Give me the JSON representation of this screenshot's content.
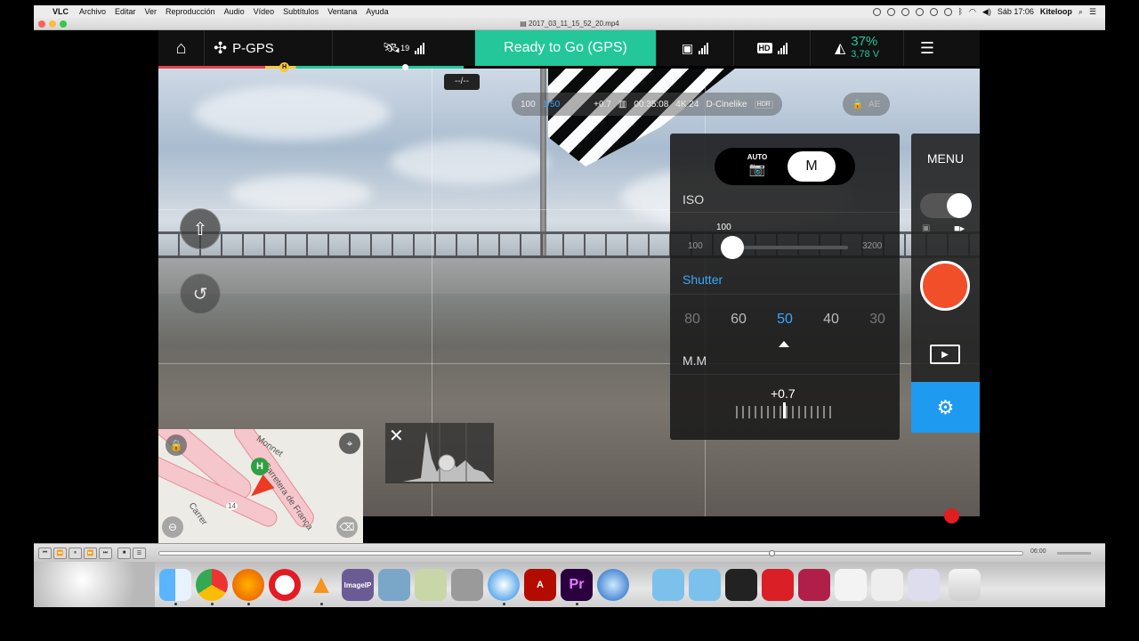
{
  "menubar": {
    "app": "VLC",
    "items": [
      "Archivo",
      "Editar",
      "Ver",
      "Reproducción",
      "Audio",
      "Vídeo",
      "Subtítulos",
      "Ventana",
      "Ayuda"
    ],
    "clock": "Sáb 17:06",
    "user": "Kiteloop"
  },
  "window": {
    "title": "2017_03_11_15_52_20.mp4"
  },
  "dji": {
    "flight_mode": "P-GPS",
    "satellites": "19",
    "status": "Ready to Go (GPS)",
    "hd_label": "HD",
    "battery_percent": "37%",
    "battery_voltage": "3,78 V",
    "home_marker": "H",
    "distance": "--/--",
    "camera": {
      "iso": "100",
      "shutter": "1/50",
      "ev": "+0.7",
      "remaining": "00:35:08",
      "resolution": "4K 24",
      "color": "D-Cinelike",
      "hdr": "HDR",
      "ae": "AE"
    },
    "exposure_panel": {
      "mode_auto": "AUTO",
      "mode_manual": "M",
      "iso_label": "ISO",
      "iso_value": "100",
      "iso_min": "100",
      "iso_max": "3200",
      "iso_fraction": 0.0,
      "shutter_label": "Shutter",
      "shutter_options": [
        "80",
        "60",
        "50",
        "40",
        "30"
      ],
      "shutter_selected": "50",
      "mm_label": "M.M",
      "ev_value": "+0.7"
    },
    "rail": {
      "menu": "MENU"
    }
  },
  "map": {
    "streets": [
      "Monnet",
      "Carretera de França",
      "Carrer",
      "14"
    ],
    "home_marker": "H"
  },
  "vlc": {
    "time": "06:00"
  },
  "dock": {
    "apps": [
      "Finder",
      "Chrome",
      "Firefox",
      "Opera",
      "VLC",
      "ImageIP",
      "Preview",
      "Image Capture",
      "Disk",
      "Safari",
      "Acrobat",
      "Premiere",
      "QuickTime",
      "Downloads",
      "Applications",
      "Folder",
      "Creative Cloud",
      "Resolve",
      "Documents",
      "Notes",
      "Files",
      "Trash"
    ]
  },
  "colors": {
    "status_green": "#23c79a",
    "record_red": "#f04f2a",
    "accent_blue": "#1e9af1"
  }
}
